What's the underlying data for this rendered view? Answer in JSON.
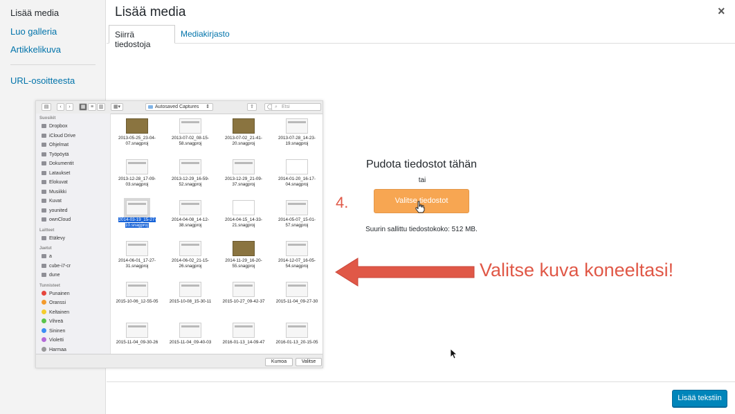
{
  "sidebar": {
    "items": [
      {
        "label": "Lisää media",
        "active": true
      },
      {
        "label": "Luo galleria",
        "active": false
      },
      {
        "label": "Artikkelikuva",
        "active": false
      },
      {
        "label": "URL-osoitteesta",
        "active": false
      }
    ]
  },
  "header": {
    "title": "Lisää media",
    "close": "×"
  },
  "tabs": [
    {
      "label": "Siirrä tiedostoja",
      "active": true
    },
    {
      "label": "Mediakirjasto",
      "active": false
    }
  ],
  "finder": {
    "path": "Autosaved Captures",
    "search_placeholder": "Etsi",
    "sidebar": {
      "sections": [
        {
          "heading": "Suosikit",
          "items": [
            "Dropbox",
            "iCloud Drive",
            "Ohjelmat",
            "Työpöytä",
            "Dokumentit",
            "Lataukset",
            "Elokuvat",
            "Musiikki",
            "Kuvat",
            "younited",
            "ownCloud"
          ]
        },
        {
          "heading": "Laitteet",
          "items": [
            "Etälevy"
          ]
        },
        {
          "heading": "Jaetut",
          "items": [
            "a",
            "cube-i7-cr",
            "dune"
          ]
        },
        {
          "heading": "Tunnisteet",
          "items": [
            "Punainen",
            "Oranssi",
            "Keltainen",
            "Vihreä",
            "Sininen",
            "Violetti",
            "Harmaa"
          ]
        }
      ],
      "tag_colors": [
        "#e6453d",
        "#f39a2d",
        "#f5cc2d",
        "#5ac44b",
        "#3d8ef5",
        "#b56ad8",
        "#999999"
      ]
    },
    "files": [
      {
        "name": "2013-05-25_23-04-07.snagproj",
        "thumb": "dark"
      },
      {
        "name": "2013-07-02_08-15-58.snagproj",
        "thumb": "light"
      },
      {
        "name": "2013-07-02_21-41-20.snagproj",
        "thumb": "dark"
      },
      {
        "name": "2013-07-28_14-23-19.snagproj",
        "thumb": "light"
      },
      {
        "name": "2013-12-28_17-09-03.snagproj",
        "thumb": "light"
      },
      {
        "name": "2013-12-29_16-59-52.snagproj",
        "thumb": "light"
      },
      {
        "name": "2013-12-29_21-09-37.snagproj",
        "thumb": "light"
      },
      {
        "name": "2014-01-20_16-17-04.snagproj",
        "thumb": "blank"
      },
      {
        "name": "2014-03-19_15-27-10.snagproj",
        "thumb": "light",
        "selected": true
      },
      {
        "name": "2014-04-08_14-12-38.snagproj",
        "thumb": "light"
      },
      {
        "name": "2014-04-15_14-33-21.snagproj",
        "thumb": "blank"
      },
      {
        "name": "2014-05-07_15-01-57.snagproj",
        "thumb": "light"
      },
      {
        "name": "2014-06-01_17-27-31.snagproj",
        "thumb": "light"
      },
      {
        "name": "2014-06-02_21-15-26.snagproj",
        "thumb": "light"
      },
      {
        "name": "2014-11-29_16-20-55.snagproj",
        "thumb": "dark"
      },
      {
        "name": "2014-12-07_16-05-54.snagproj",
        "thumb": "light"
      },
      {
        "name": "2015-10-06_12-55-05",
        "thumb": "light"
      },
      {
        "name": "2015-10-08_15-30-11",
        "thumb": "light"
      },
      {
        "name": "2015-10-27_09-42-37",
        "thumb": "light"
      },
      {
        "name": "2015-11-04_09-27-30",
        "thumb": "light"
      },
      {
        "name": "2015-11-04_09-30-26",
        "thumb": "light"
      },
      {
        "name": "2015-11-04_09-40-03",
        "thumb": "light"
      },
      {
        "name": "2016-01-13_14-09-47",
        "thumb": "light"
      },
      {
        "name": "2016-01-13_20-15-05",
        "thumb": "light"
      }
    ],
    "cancel_label": "Kumoa",
    "choose_label": "Valitse"
  },
  "dropzone": {
    "title": "Pudota tiedostot tähän",
    "or": "tai",
    "button_label": "Valitse tiedostot",
    "max_size": "Suurin sallittu tiedostokoko: 512 MB."
  },
  "annotation": {
    "step": "4.",
    "callout": "Valitse kuva koneeltasi!",
    "color": "#e05847"
  },
  "footer": {
    "insert_label": "Lisää tekstiin"
  }
}
